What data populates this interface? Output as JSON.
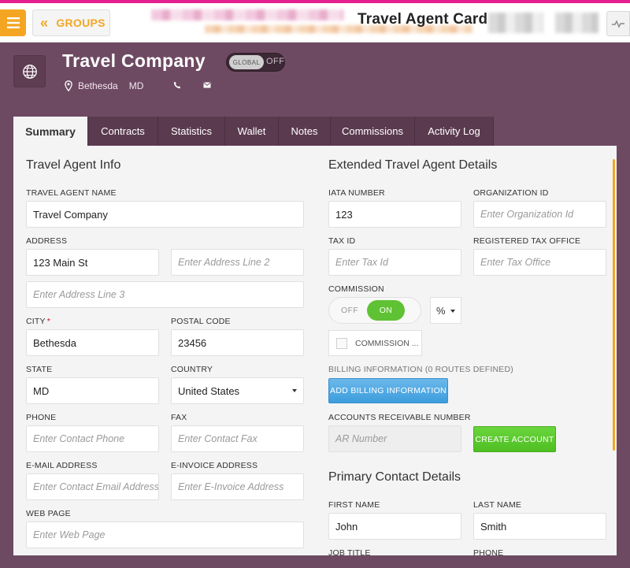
{
  "header": {
    "app_title": "Travel Agent Card",
    "groups_label": "GROUPS"
  },
  "entity": {
    "name": "Travel Company",
    "global_toggle": {
      "knob_label": "GLOBAL",
      "state_label": "OFF"
    },
    "city": "Bethesda",
    "state": "MD"
  },
  "tabs": [
    {
      "label": "Summary",
      "active": true
    },
    {
      "label": "Contracts"
    },
    {
      "label": "Statistics"
    },
    {
      "label": "Wallet"
    },
    {
      "label": "Notes"
    },
    {
      "label": "Commissions"
    },
    {
      "label": "Activity Log"
    }
  ],
  "info": {
    "title": "Travel Agent Info",
    "name_label": "TRAVEL AGENT NAME",
    "name_value": "Travel Company",
    "address_label": "ADDRESS",
    "address1_value": "123 Main St",
    "address2_placeholder": "Enter Address Line 2",
    "address3_placeholder": "Enter Address Line 3",
    "city_label": "CITY",
    "city_required": "*",
    "city_value": "Bethesda",
    "postal_label": "POSTAL CODE",
    "postal_value": "23456",
    "state_label": "STATE",
    "state_value": "MD",
    "country_label": "COUNTRY",
    "country_value": "United States",
    "phone_label": "PHONE",
    "phone_placeholder": "Enter Contact Phone",
    "fax_label": "FAX",
    "fax_placeholder": "Enter Contact Fax",
    "email_label": "E-MAIL ADDRESS",
    "email_placeholder": "Enter Contact Email Address",
    "einvoice_label": "E-INVOICE ADDRESS",
    "einvoice_placeholder": "Enter E-Invoice Address",
    "web_label": "WEB PAGE",
    "web_placeholder": "Enter Web Page"
  },
  "extended": {
    "title": "Extended Travel Agent Details",
    "iata_label": "IATA NUMBER",
    "iata_value": "123",
    "org_label": "ORGANIZATION ID",
    "org_placeholder": "Enter Organization Id",
    "tax_label": "TAX ID",
    "tax_placeholder": "Enter Tax Id",
    "office_label": "REGISTERED TAX OFFICE",
    "office_placeholder": "Enter Tax Office",
    "commission_label": "COMMISSION",
    "commission_off": "OFF",
    "commission_on": "ON",
    "commission_unit": "%",
    "commission_check_label": "COMMISSION ...",
    "billing_label": "BILLING INFORMATION (0 ROUTES DEFINED)",
    "billing_button": "ADD BILLING INFORMATION",
    "ar_label": "ACCOUNTS RECEIVABLE NUMBER",
    "ar_placeholder": "AR Number",
    "create_account_button": "CREATE ACCOUNT"
  },
  "contact": {
    "title": "Primary Contact Details",
    "first_label": "FIRST NAME",
    "first_value": "John",
    "last_label": "LAST NAME",
    "last_value": "Smith",
    "job_label": "JOB TITLE",
    "phone_label": "PHONE"
  },
  "colors": {
    "brand_orange": "#f4a623",
    "header_purple": "#6e4a62",
    "toggle_green": "#5fc234",
    "button_blue": "#3d9ddd"
  }
}
